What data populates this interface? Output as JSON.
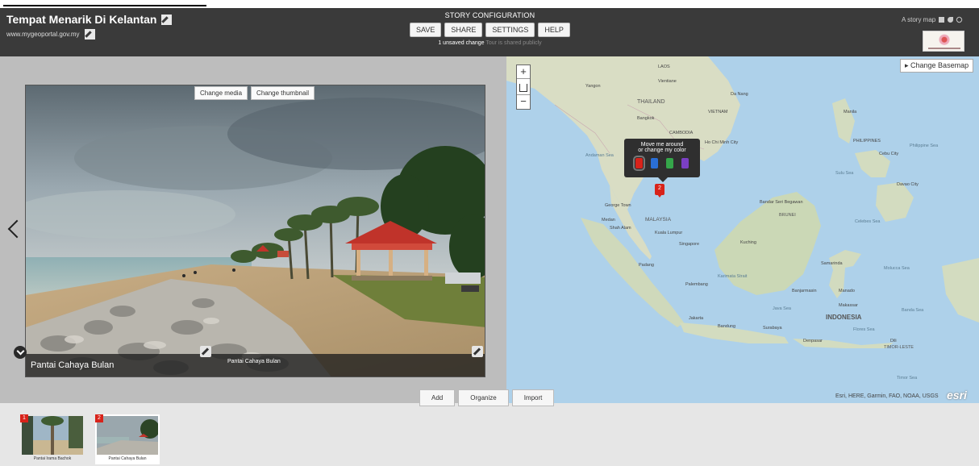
{
  "header": {
    "title": "Tempat Menarik Di Kelantan",
    "subtitle": "www.mygeoportal.gov.my",
    "config_label": "STORY CONFIGURATION",
    "buttons": [
      "SAVE",
      "SHARE",
      "SETTINGS",
      "HELP"
    ],
    "unsaved": "1 unsaved change",
    "shared": "Tour is shared publicly",
    "storymap_label": "A story map"
  },
  "media": {
    "change_media": "Change media",
    "change_thumbnail": "Change thumbnail",
    "caption_title": "Pantai Cahaya Bulan",
    "caption_text": "Pantai Cahaya Bulan"
  },
  "map": {
    "basemap_button": "Change Basemap",
    "tooltip_line1": "Move me around",
    "tooltip_line2": "or change my color",
    "color_options": [
      "red",
      "blue",
      "green",
      "purple"
    ],
    "color_values": [
      "#d8231a",
      "#2a6fd6",
      "#35a64a",
      "#7b3fc4"
    ],
    "pin_number": "2",
    "attribution": "Esri, HERE, Garmin, FAO, NOAA, USGS",
    "esri_logo": "esri",
    "labels": {
      "laos": "LAOS",
      "vientiane": "Vientiane",
      "da_nang": "Da Nang",
      "yangon": "Yangon",
      "thailand": "THAILAND",
      "vietnam": "VIETNAM",
      "bangkok": "Bangkok",
      "cambodia": "CAMBODIA",
      "ho_chi_minh": "Ho Chi Minh City",
      "andaman": "Andaman Sea",
      "manila": "Manila",
      "philippines": "PHILIPPINES",
      "philippine_sea": "Philippine Sea",
      "cebu": "Cebu City",
      "sulu": "Sulu Sea",
      "davao": "Davao City",
      "george_town": "George Town",
      "medan": "Medan",
      "malaysia": "MALAYSIA",
      "shah_alam": "Shah Alam",
      "kuala_lumpur": "Kuala Lumpur",
      "singapore": "Singapore",
      "bandar": "Bandar Seri Begawan",
      "brunei": "BRUNEI",
      "kuching": "Kuching",
      "celebes": "Celebes Sea",
      "padang": "Padang",
      "palembang": "Palembang",
      "karimata": "Karimata Strait",
      "samarinda": "Samarinda",
      "molucca": "Molucca Sea",
      "banjarmasin": "Banjarmasin",
      "manado": "Manado",
      "makassar": "Makassar",
      "banda": "Banda Sea",
      "java_sea": "Java Sea",
      "indonesia": "INDONESIA",
      "jakarta": "Jakarta",
      "bandung": "Bandung",
      "surabaya": "Surabaya",
      "denpasar": "Denpasar",
      "dili": "Dili",
      "timor_leste": "TIMOR-LESTE",
      "flores": "Flores Sea",
      "timor_sea": "Timor Sea"
    }
  },
  "bottom": {
    "buttons": [
      "Add",
      "Organize",
      "Import"
    ],
    "thumbs": [
      {
        "number": "1",
        "label": "Pantai Irama Bachok"
      },
      {
        "number": "2",
        "label": "Pantai Cahaya Bulan"
      }
    ]
  }
}
